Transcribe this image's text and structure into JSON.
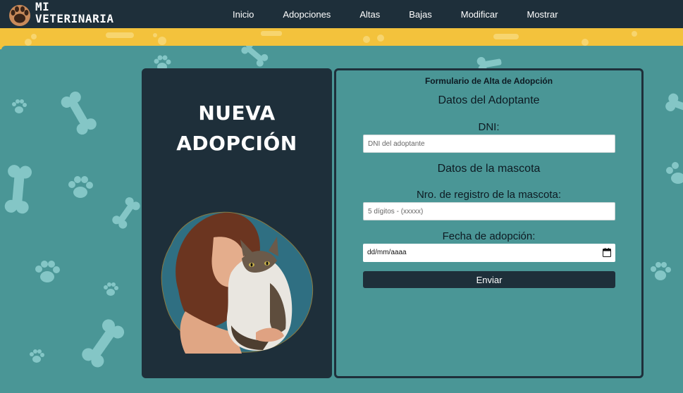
{
  "header": {
    "brand_line1": "MI",
    "brand_line2": "VETERINARIA",
    "nav": [
      {
        "label": "Inicio"
      },
      {
        "label": "Adopciones"
      },
      {
        "label": "Altas"
      },
      {
        "label": "Bajas"
      },
      {
        "label": "Modificar"
      },
      {
        "label": "Mostrar"
      }
    ]
  },
  "hero": {
    "title_line1": "NUEVA",
    "title_line2": "ADOPCIÓN",
    "image": "woman-hugging-cat-photo"
  },
  "form": {
    "title": "Formulario de Alta de Adopción",
    "adopter_section": "Datos del Adoptante",
    "dni_label": "DNI:",
    "dni_placeholder": "DNI del adoptante",
    "pet_section": "Datos de la mascota",
    "registry_label": "Nro. de registro de la mascota:",
    "registry_placeholder": "5 dígitos - (xxxxx)",
    "date_label": "Fecha de adopción:",
    "date_placeholder": "dd/mm/aaaa",
    "submit_label": "Enviar"
  },
  "colors": {
    "navbar": "#1e2f3a",
    "band": "#f3c23c",
    "background": "#4a9696",
    "decoration": "#8fcfcf"
  },
  "icons": [
    "paw-logo-icon",
    "bone-icon",
    "paw-print-icon",
    "calendar-icon"
  ]
}
